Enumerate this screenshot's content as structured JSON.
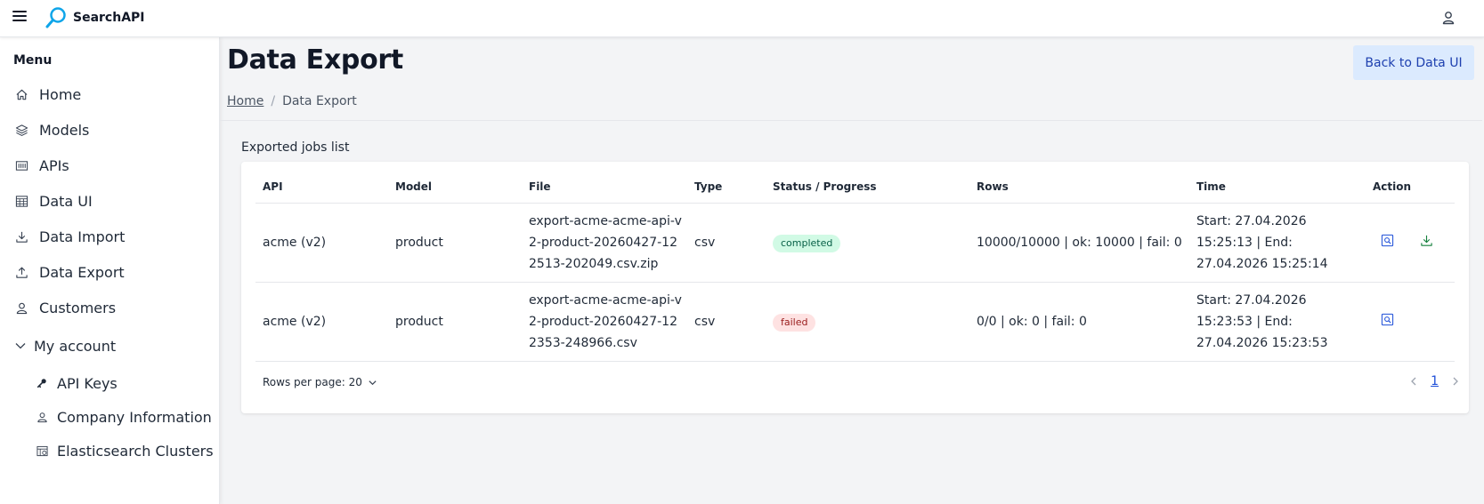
{
  "app": {
    "name": "SearchAPI",
    "colors": {
      "accent": "#1d4ed8",
      "logo": "#0ea5e9",
      "success": "#065f46",
      "danger": "#991b1b"
    }
  },
  "topbar": {
    "menu_icon": "hamburger-icon",
    "user_icon": "user-icon"
  },
  "sidebar": {
    "title": "Menu",
    "items": [
      {
        "label": "Home",
        "icon": "home-icon"
      },
      {
        "label": "Models",
        "icon": "layers-icon"
      },
      {
        "label": "APIs",
        "icon": "api-icon"
      },
      {
        "label": "Data UI",
        "icon": "calendar-grid-icon"
      },
      {
        "label": "Data Import",
        "icon": "download-icon"
      },
      {
        "label": "Data Export",
        "icon": "upload-icon"
      },
      {
        "label": "Customers",
        "icon": "user-icon"
      }
    ],
    "group": {
      "label": "My account",
      "icon": "chevron-down-icon",
      "items": [
        {
          "label": "API Keys",
          "icon": "key-icon"
        },
        {
          "label": "Company Information",
          "icon": "user-icon"
        },
        {
          "label": "Elasticsearch Clusters",
          "icon": "cluster-icon"
        }
      ]
    }
  },
  "page": {
    "title": "Data Export",
    "back_button": "Back to Data UI",
    "breadcrumb": {
      "home": "Home",
      "current": "Data Export"
    },
    "section_title": "Exported jobs list"
  },
  "table": {
    "headers": {
      "api": "API",
      "model": "Model",
      "file": "File",
      "type": "Type",
      "status": "Status / Progress",
      "rows": "Rows",
      "time": "Time",
      "action": "Action"
    },
    "rows": [
      {
        "api": "acme (v2)",
        "model": "product",
        "file": "export-acme-acme-api-v2-product-20260427-122513-202049.csv.zip",
        "type": "csv",
        "status": "completed",
        "rows": "10000/10000 | ok: 10000 | fail: 0",
        "time": "Start: 27.04.2026 15:25:13 | End: 27.04.2026 15:25:14",
        "actions": [
          "view-icon",
          "download-icon"
        ]
      },
      {
        "api": "acme (v2)",
        "model": "product",
        "file": "export-acme-acme-api-v2-product-20260427-122353-248966.csv",
        "type": "csv",
        "status": "failed",
        "rows": "0/0 | ok: 0 | fail: 0",
        "time": "Start: 27.04.2026 15:23:53 | End: 27.04.2026 15:23:53",
        "actions": [
          "view-icon"
        ]
      }
    ]
  },
  "pagination": {
    "rows_per_page": "Rows per page: 20",
    "current_page": "1"
  }
}
